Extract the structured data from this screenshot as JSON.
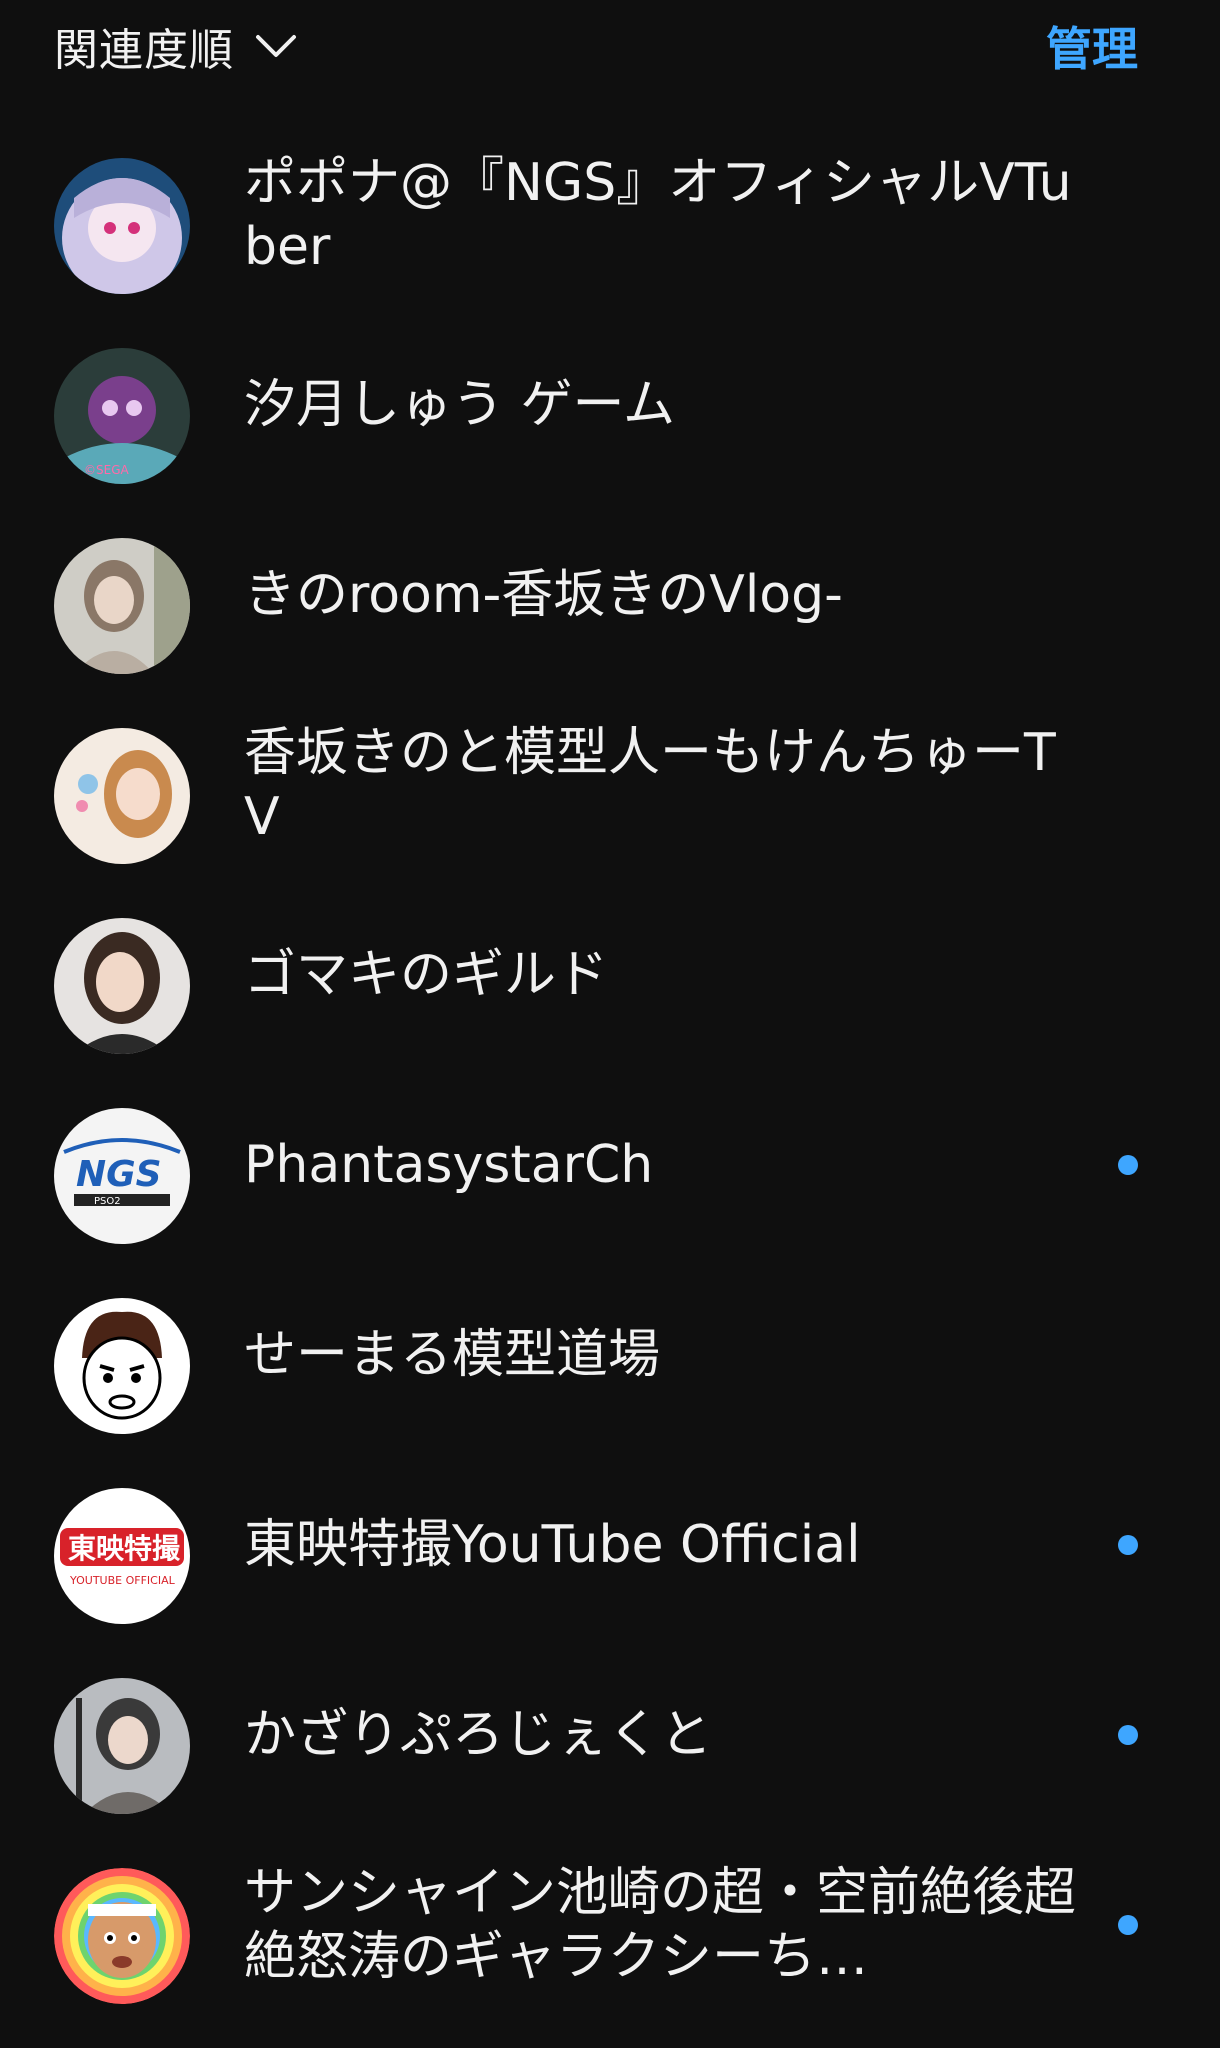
{
  "header": {
    "sort_label": "関連度順",
    "manage_label": "管理"
  },
  "colors": {
    "background": "#0f0f0f",
    "text": "#f1f1f1",
    "accent": "#3ea6ff"
  },
  "channels": [
    {
      "name": "ポポナ@『NGS』オフィシャルVTuber",
      "new_content": false
    },
    {
      "name": "汐月しゅう ゲーム",
      "new_content": false
    },
    {
      "name": "きのroom-香坂きのVlog-",
      "new_content": false
    },
    {
      "name": "香坂きのと模型人ーもけんちゅーTV",
      "new_content": false
    },
    {
      "name": "ゴマキのギルド",
      "new_content": false
    },
    {
      "name": "PhantasystarCh",
      "new_content": true
    },
    {
      "name": "せーまる模型道場",
      "new_content": false
    },
    {
      "name": "東映特撮YouTube Official",
      "new_content": true
    },
    {
      "name": "かざりぷろじぇくと",
      "new_content": true
    },
    {
      "name": "サンシャイン池崎の超・空前絶後超絶怒涛のギャラクシーち…",
      "new_content": true
    }
  ]
}
